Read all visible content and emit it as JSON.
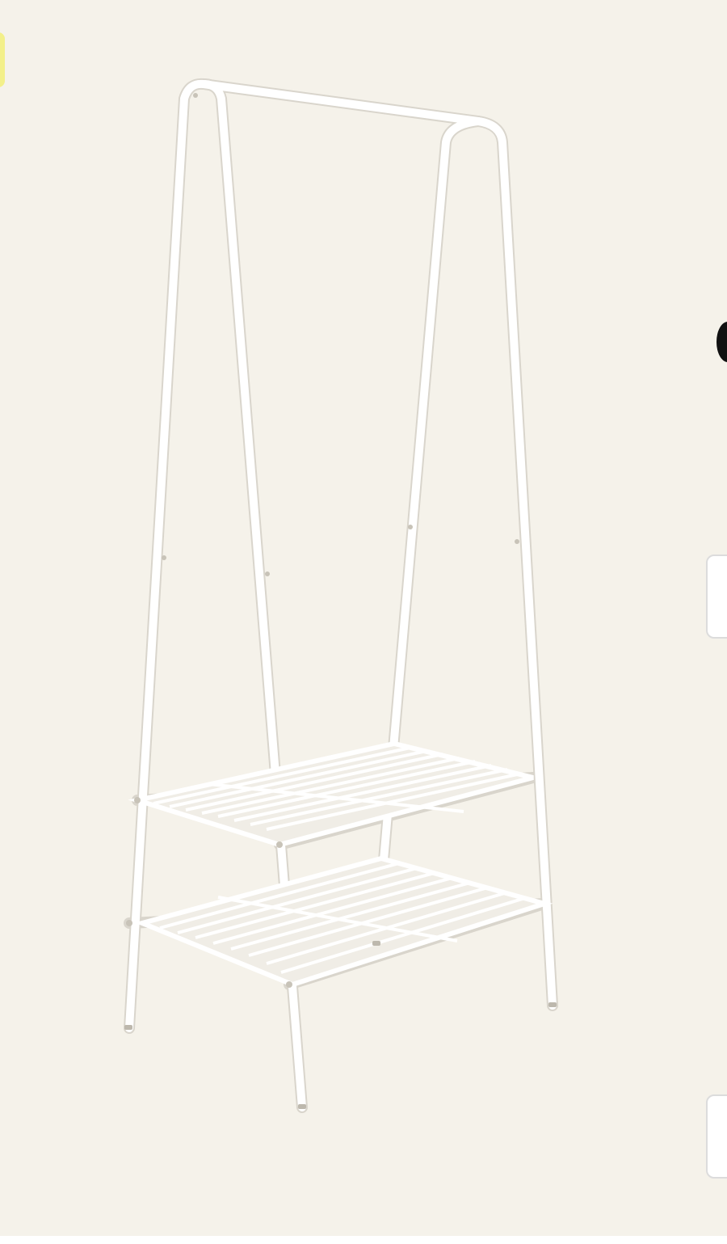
{
  "product_image": {
    "subject": "white-metal-garment-rack-with-two-shelves"
  },
  "carousel": {
    "next_cards": [
      {
        "state": "partially-visible"
      },
      {
        "state": "partially-visible"
      }
    ]
  },
  "colors": {
    "panel_background": "#f5f2ea",
    "rack_white": "#ffffff",
    "rack_shadow": "#d9d5cc",
    "badge_yellow": "#f3f08a",
    "thumb_border": "#dcdcdc"
  }
}
